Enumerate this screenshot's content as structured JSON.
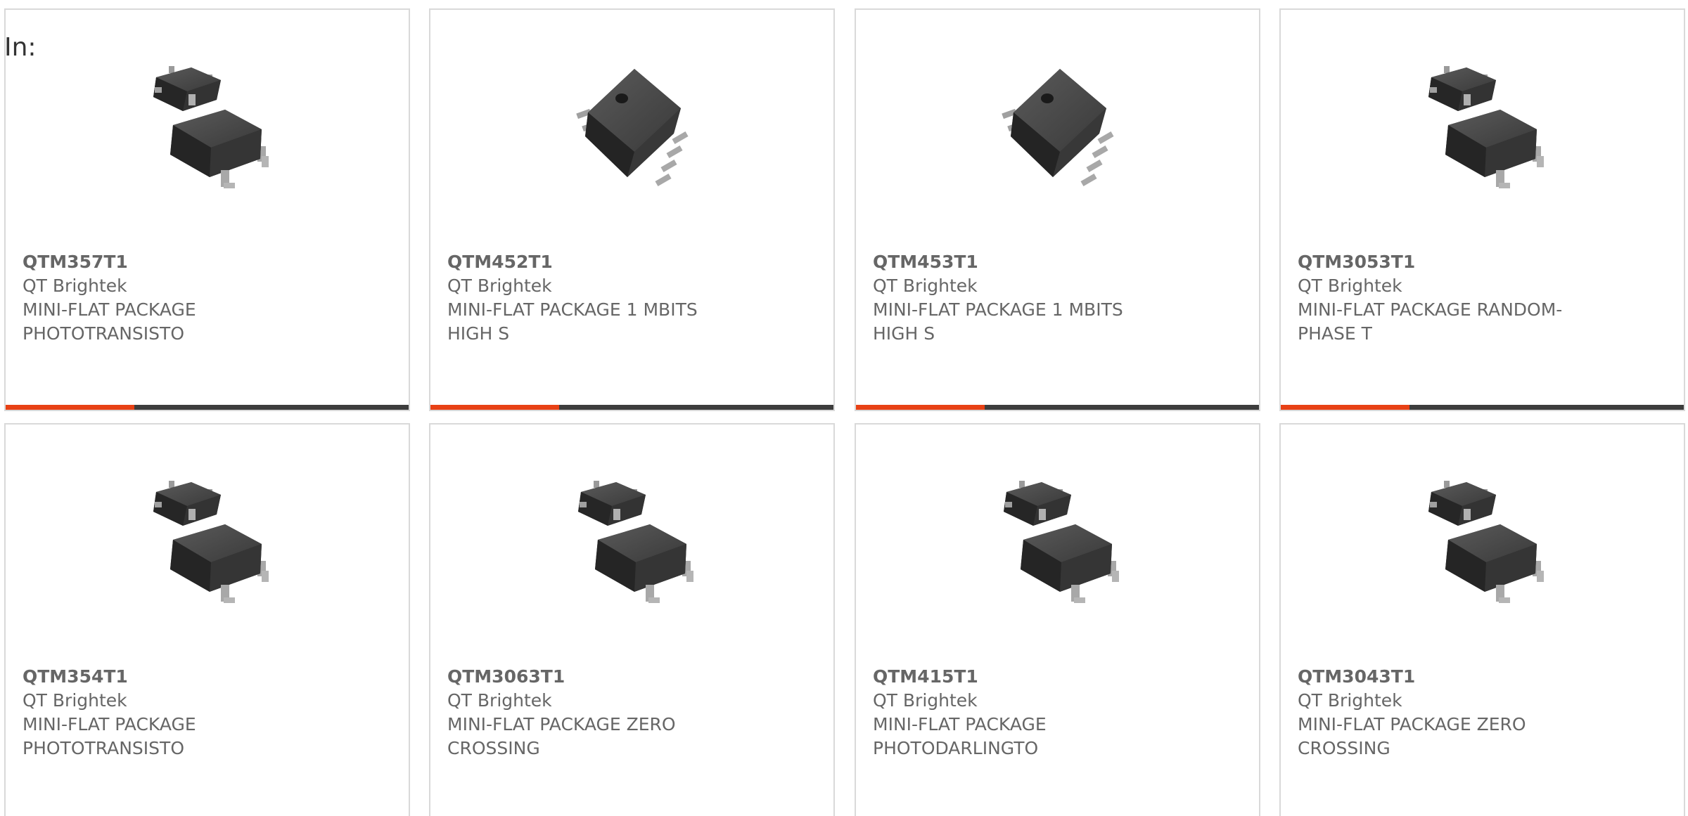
{
  "header": {
    "in_label": "In:"
  },
  "colors": {
    "accent": "#e84115",
    "bar_dark": "#3d3d3d",
    "text": "#666666",
    "border": "#d9d9d9"
  },
  "cards": [
    {
      "part": "QTM357T1",
      "mfr": "QT Brightek",
      "desc1": "MINI-FLAT PACKAGE",
      "desc2": "PHOTOTRANSISTO",
      "image": "mini-flat-package-pair"
    },
    {
      "part": "QTM452T1",
      "mfr": "QT Brightek",
      "desc1": "MINI-FLAT PACKAGE 1 MBITS",
      "desc2": "HIGH S",
      "image": "mini-flat-package-angled"
    },
    {
      "part": "QTM453T1",
      "mfr": "QT Brightek",
      "desc1": "MINI-FLAT PACKAGE 1 MBITS",
      "desc2": "HIGH S",
      "image": "mini-flat-package-angled"
    },
    {
      "part": "QTM3053T1",
      "mfr": "QT Brightek",
      "desc1": "MINI-FLAT PACKAGE RANDOM-",
      "desc2": "PHASE T",
      "image": "mini-flat-package-pair"
    },
    {
      "part": "QTM354T1",
      "mfr": "QT Brightek",
      "desc1": "MINI-FLAT PACKAGE",
      "desc2": "PHOTOTRANSISTO",
      "image": "mini-flat-package-pair"
    },
    {
      "part": "QTM3063T1",
      "mfr": "QT Brightek",
      "desc1": "MINI-FLAT PACKAGE ZERO",
      "desc2": "CROSSING",
      "image": "mini-flat-package-pair"
    },
    {
      "part": "QTM415T1",
      "mfr": "QT Brightek",
      "desc1": "MINI-FLAT PACKAGE",
      "desc2": "PHOTODARLINGTO",
      "image": "mini-flat-package-pair"
    },
    {
      "part": "QTM3043T1",
      "mfr": "QT Brightek",
      "desc1": "MINI-FLAT PACKAGE ZERO",
      "desc2": "CROSSING",
      "image": "mini-flat-package-pair"
    }
  ]
}
